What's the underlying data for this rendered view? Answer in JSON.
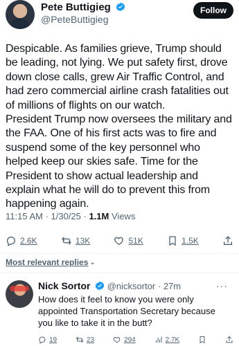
{
  "post": {
    "author_name": "Pete Buttigieg",
    "author_handle": "@PeteButtigieg",
    "follow_label": "Follow",
    "body": "Despicable. As families grieve, Trump should be leading, not lying. We put safety first, drove down close calls, grew Air Traffic Control, and had zero commercial airline crash fatalities out of millions of flights on our watch.\nPresident Trump now oversees the military and the FAA. One of his first acts was to fire and suspend some of the key personnel who helped keep our skies safe. Time for the President to show actual leadership and explain what he will do to prevent this from happening again.",
    "timestamp": "11:15 AM · 1/30/25 ·",
    "views_count": "1.1M",
    "views_label": "Views",
    "actions": {
      "replies": "2.6K",
      "reposts": "13K",
      "likes": "51K",
      "bookmarks": "1.5K"
    }
  },
  "replies_section": {
    "sort_label": "Most relevant replies",
    "chevron_icon": "chevron-down-icon"
  },
  "reply": {
    "author_name": "Nick Sortor",
    "author_handle": "@nicksortor",
    "time": "· 27m",
    "more_icon": "ellipsis-icon",
    "text": "How does it feel to know you were only appointed Transportation Secretary because you like to take it in the butt?",
    "actions": {
      "replies": "19",
      "reposts": "23",
      "likes": "294",
      "views": "2.7K"
    }
  },
  "colors": {
    "verified_blue": "#1d9bf0",
    "text_primary": "#0f1419",
    "text_secondary": "#536471",
    "follow_button": "#0f1419"
  }
}
